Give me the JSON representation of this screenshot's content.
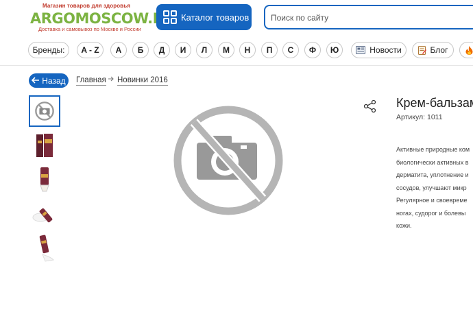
{
  "header": {
    "logo": {
      "tagline_top": "Магазин товаров для здоровья",
      "brand": "ARGOMOSCOW.RU",
      "tagline_bottom": "Доставка и самовывоз по Москве и России"
    },
    "catalog_button": "Каталог товаров",
    "search_placeholder": "Поиск по сайту"
  },
  "nav": {
    "brands_label": "Бренды:",
    "az_label": "A - Z",
    "letters": [
      "А",
      "Б",
      "Д",
      "И",
      "Л",
      "М",
      "Н",
      "П",
      "С",
      "Ф",
      "Ю"
    ],
    "news_label": "Новости",
    "blog_label": "Блог",
    "icons": {
      "news": "newspaper-icon",
      "blog": "blog-icon",
      "partial": "fire-icon"
    }
  },
  "breadcrumb": {
    "back_label": "Назад",
    "items": [
      "Главная",
      "Новинки 2016"
    ]
  },
  "product": {
    "title": "Крем-бальзам",
    "sku": "Артикул: 1011",
    "description_lines": [
      "Активные природные ком",
      "биологически активных в",
      "дерматита, уплотнение и",
      "сосудов, улучшают микр",
      "Регулярное и своевреме",
      "ногах, судорог и болевы",
      "кожи."
    ],
    "main_image": "no-photo-icon",
    "thumbnails": [
      "no-photo-icon",
      "cream-box-icon",
      "cream-tube-icon",
      "cream-tube-smear-icon",
      "cream-tube-open-icon"
    ]
  },
  "colors": {
    "accent": "#1565c0",
    "brand_green": "#7cb342",
    "brand_red": "#c0392b"
  }
}
